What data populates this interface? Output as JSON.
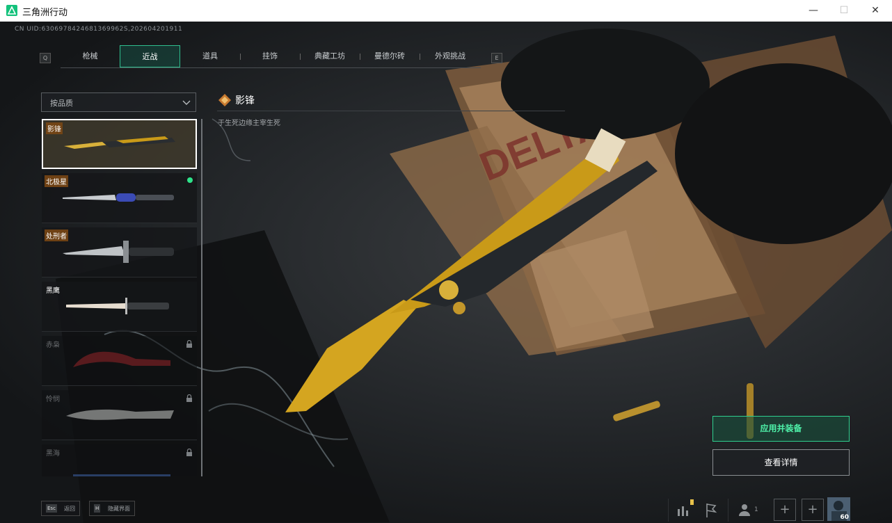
{
  "window": {
    "title": "三角洲行动",
    "minimize": "—",
    "maximize": "☐",
    "close": "✕"
  },
  "uid": "CN UID:6306978424681369962S,202604201911",
  "tabs": {
    "left_key": "Q",
    "right_key": "E",
    "items": [
      {
        "label": "枪械"
      },
      {
        "label": "近战",
        "active": true
      },
      {
        "label": "道具"
      },
      {
        "label": "挂饰"
      },
      {
        "label": "典藏工坊"
      },
      {
        "label": "曼德尔砖"
      },
      {
        "label": "外观挑战"
      }
    ]
  },
  "sort": {
    "label": "按品质",
    "icon": "chevron-down-icon"
  },
  "items": [
    {
      "name": "影锋",
      "selected": true,
      "locked": false,
      "equipped": false
    },
    {
      "name": "北极星",
      "selected": false,
      "locked": false,
      "equipped": true
    },
    {
      "name": "处刑者",
      "selected": false,
      "locked": false,
      "equipped": false
    },
    {
      "name": "黑鹰",
      "selected": false,
      "locked": false,
      "equipped": false
    },
    {
      "name": "赤枭",
      "selected": false,
      "locked": true,
      "equipped": false
    },
    {
      "name": "怜悯",
      "selected": false,
      "locked": true,
      "equipped": false
    },
    {
      "name": "黑海",
      "selected": false,
      "locked": true,
      "equipped": false
    }
  ],
  "detail": {
    "name": "影锋",
    "description": "于生死边缘主宰生死"
  },
  "actions": {
    "apply": "应用并装备",
    "view": "查看详情"
  },
  "bottom": {
    "back_key": "Esc",
    "back_label": "返回",
    "hide_key": "H",
    "hide_label": "隐藏界面",
    "friend_count": "1",
    "avatar_level": "60"
  },
  "colors": {
    "accent": "#2fd08f",
    "gold": "#d4a520",
    "equipped": "#2ee38a"
  }
}
